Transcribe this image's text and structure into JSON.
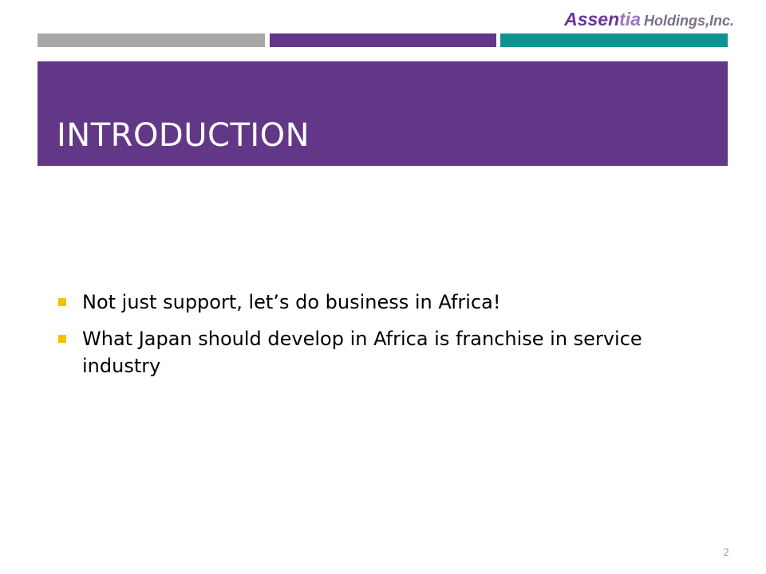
{
  "logo": {
    "part1": "Assen",
    "part2": "tia",
    "part3": "Holdings,Inc."
  },
  "colors": {
    "stripe_gray": "#a8a8a8",
    "stripe_purple": "#633787",
    "stripe_teal": "#0f9291",
    "title_band": "#633787",
    "bullet_marker": "#f2c200"
  },
  "slide": {
    "title": "INTRODUCTION",
    "bullets": [
      "Not just support, let’s do business in Africa!",
      "What Japan should develop in Africa is franchise in service industry"
    ],
    "page_number": "2"
  }
}
